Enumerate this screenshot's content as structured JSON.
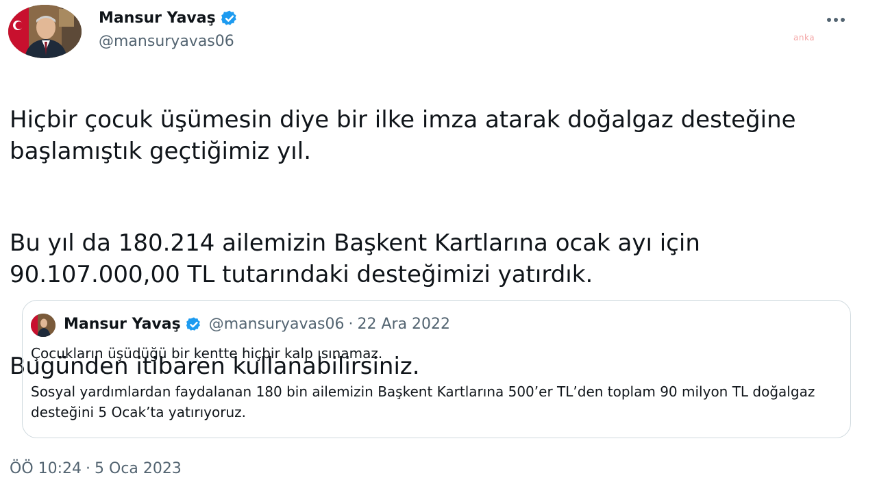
{
  "author": {
    "name": "Mansur Yavaş",
    "handle": "@mansuryavas06",
    "verified_icon": "verified-badge-icon",
    "avatar_icon": "profile-photo"
  },
  "menu": {
    "more_icon": "more-dots-icon"
  },
  "watermark": {
    "text": "anka"
  },
  "tweet": {
    "paragraphs": [
      "Hiçbir çocuk üşümesin diye bir ilke imza atarak doğalgaz desteğine başlamıştık geçtiğimiz yıl.",
      "Bu yıl da 180.214 ailemizin Başkent Kartlarına ocak ayı için 90.107.000,00 TL tutarındaki desteğimizi yatırdık.",
      "Bugünden itibaren kullanabilirsiniz."
    ]
  },
  "quoted_tweet": {
    "name": "Mansur Yavaş",
    "handle": "@mansuryavas06",
    "separator": "·",
    "date": "22 Ara 2022",
    "paragraphs": [
      "Çocukların üşüdüğü bir kentte hiçbir kalp ısınamaz.",
      "Sosyal yardımlardan faydalanan 180 bin ailemizin Başkent Kartlarına 500’er TL’den toplam 90 milyon TL doğalgaz desteğini 5 Ocak’ta yatırıyoruz."
    ]
  },
  "timestamp": {
    "time": "ÖÖ 10:24",
    "separator": "·",
    "date": "5 Oca 2023"
  },
  "colors": {
    "verified_blue": "#1d9bf0",
    "text_primary": "#0f1419",
    "text_secondary": "#536471",
    "border": "#cfd9de"
  }
}
